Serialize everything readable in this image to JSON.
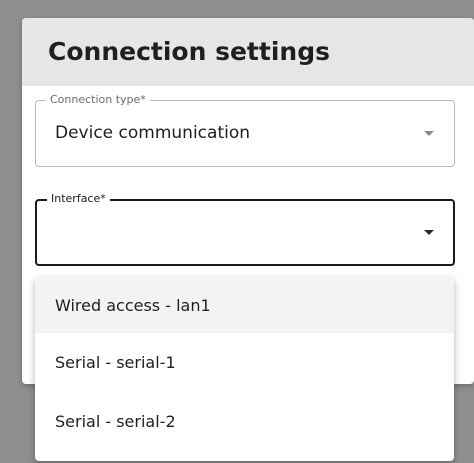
{
  "dialog": {
    "title": "Connection settings"
  },
  "connection_type": {
    "label": "Connection type*",
    "value": "Device communication"
  },
  "interface": {
    "label": "Interface*",
    "value": "",
    "options": [
      {
        "label": "Wired access - lan1",
        "highlighted": true
      },
      {
        "label": "Serial - serial-1",
        "highlighted": false
      },
      {
        "label": "Serial - serial-2",
        "highlighted": false
      }
    ]
  },
  "icons": {
    "dropdown": "caret-down-icon"
  },
  "colors": {
    "overlay": "#8f8f8f",
    "header_bg": "#e6e6e6",
    "focused_border": "#1a1a1a",
    "idle_border": "#b9b9b9",
    "highlight_bg": "#f3f3f3"
  }
}
